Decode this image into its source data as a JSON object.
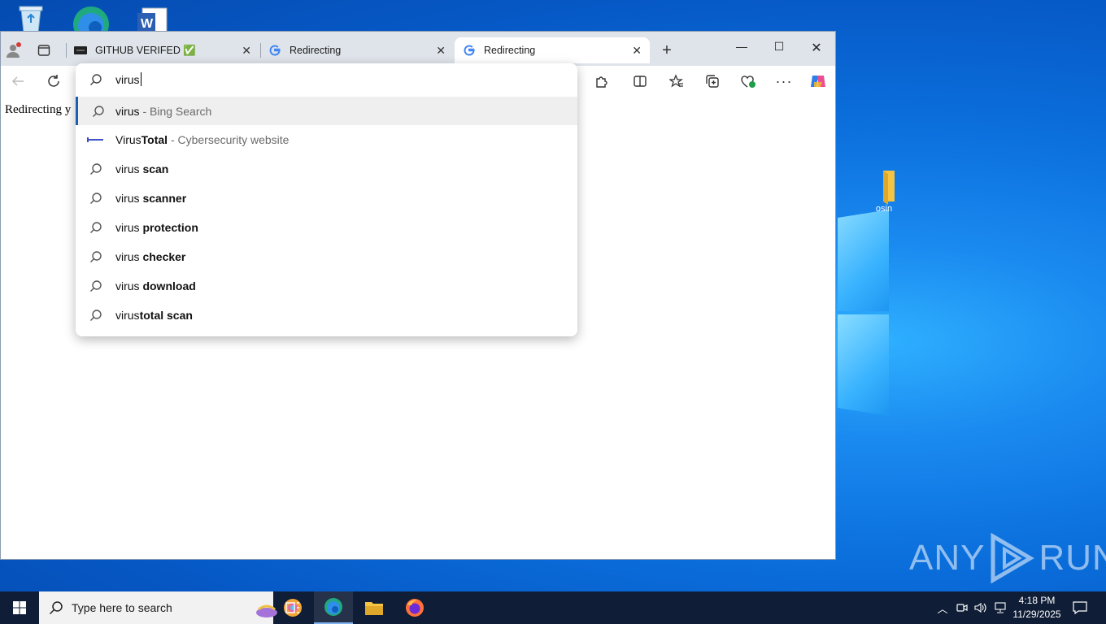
{
  "desktop": {
    "icons": [
      {
        "name": "recycle-bin",
        "label": ""
      },
      {
        "name": "edge",
        "label": ""
      },
      {
        "name": "word",
        "label": ""
      },
      {
        "name": "folder",
        "label": "osin"
      }
    ],
    "watermark": "ANY RUN"
  },
  "browser": {
    "tabs": [
      {
        "title": "GITHUB VERIFED ✅",
        "active": false
      },
      {
        "title": "Redirecting",
        "active": false
      },
      {
        "title": "Redirecting",
        "active": true
      }
    ],
    "page_text": "Redirecting y"
  },
  "omnibox": {
    "typed": "virus",
    "suggestions": [
      {
        "prefix": "virus",
        "bold": "",
        "suffix": " - Bing Search",
        "type": "search",
        "selected": true
      },
      {
        "prefix": "Virus",
        "bold": "Total",
        "suffix": " - Cybersecurity website",
        "type": "site",
        "selected": false
      },
      {
        "prefix": "virus ",
        "bold": "scan",
        "suffix": "",
        "type": "search",
        "selected": false
      },
      {
        "prefix": "virus ",
        "bold": "scanner",
        "suffix": "",
        "type": "search",
        "selected": false
      },
      {
        "prefix": "virus ",
        "bold": "protection",
        "suffix": "",
        "type": "search",
        "selected": false
      },
      {
        "prefix": "virus ",
        "bold": "checker",
        "suffix": "",
        "type": "search",
        "selected": false
      },
      {
        "prefix": "virus ",
        "bold": "download",
        "suffix": "",
        "type": "search",
        "selected": false
      },
      {
        "prefix": "virus",
        "bold": "total scan",
        "suffix": "",
        "type": "search",
        "selected": false
      }
    ]
  },
  "taskbar": {
    "search_placeholder": "Type here to search",
    "time": "4:18 PM",
    "date": "11/29/2025"
  }
}
